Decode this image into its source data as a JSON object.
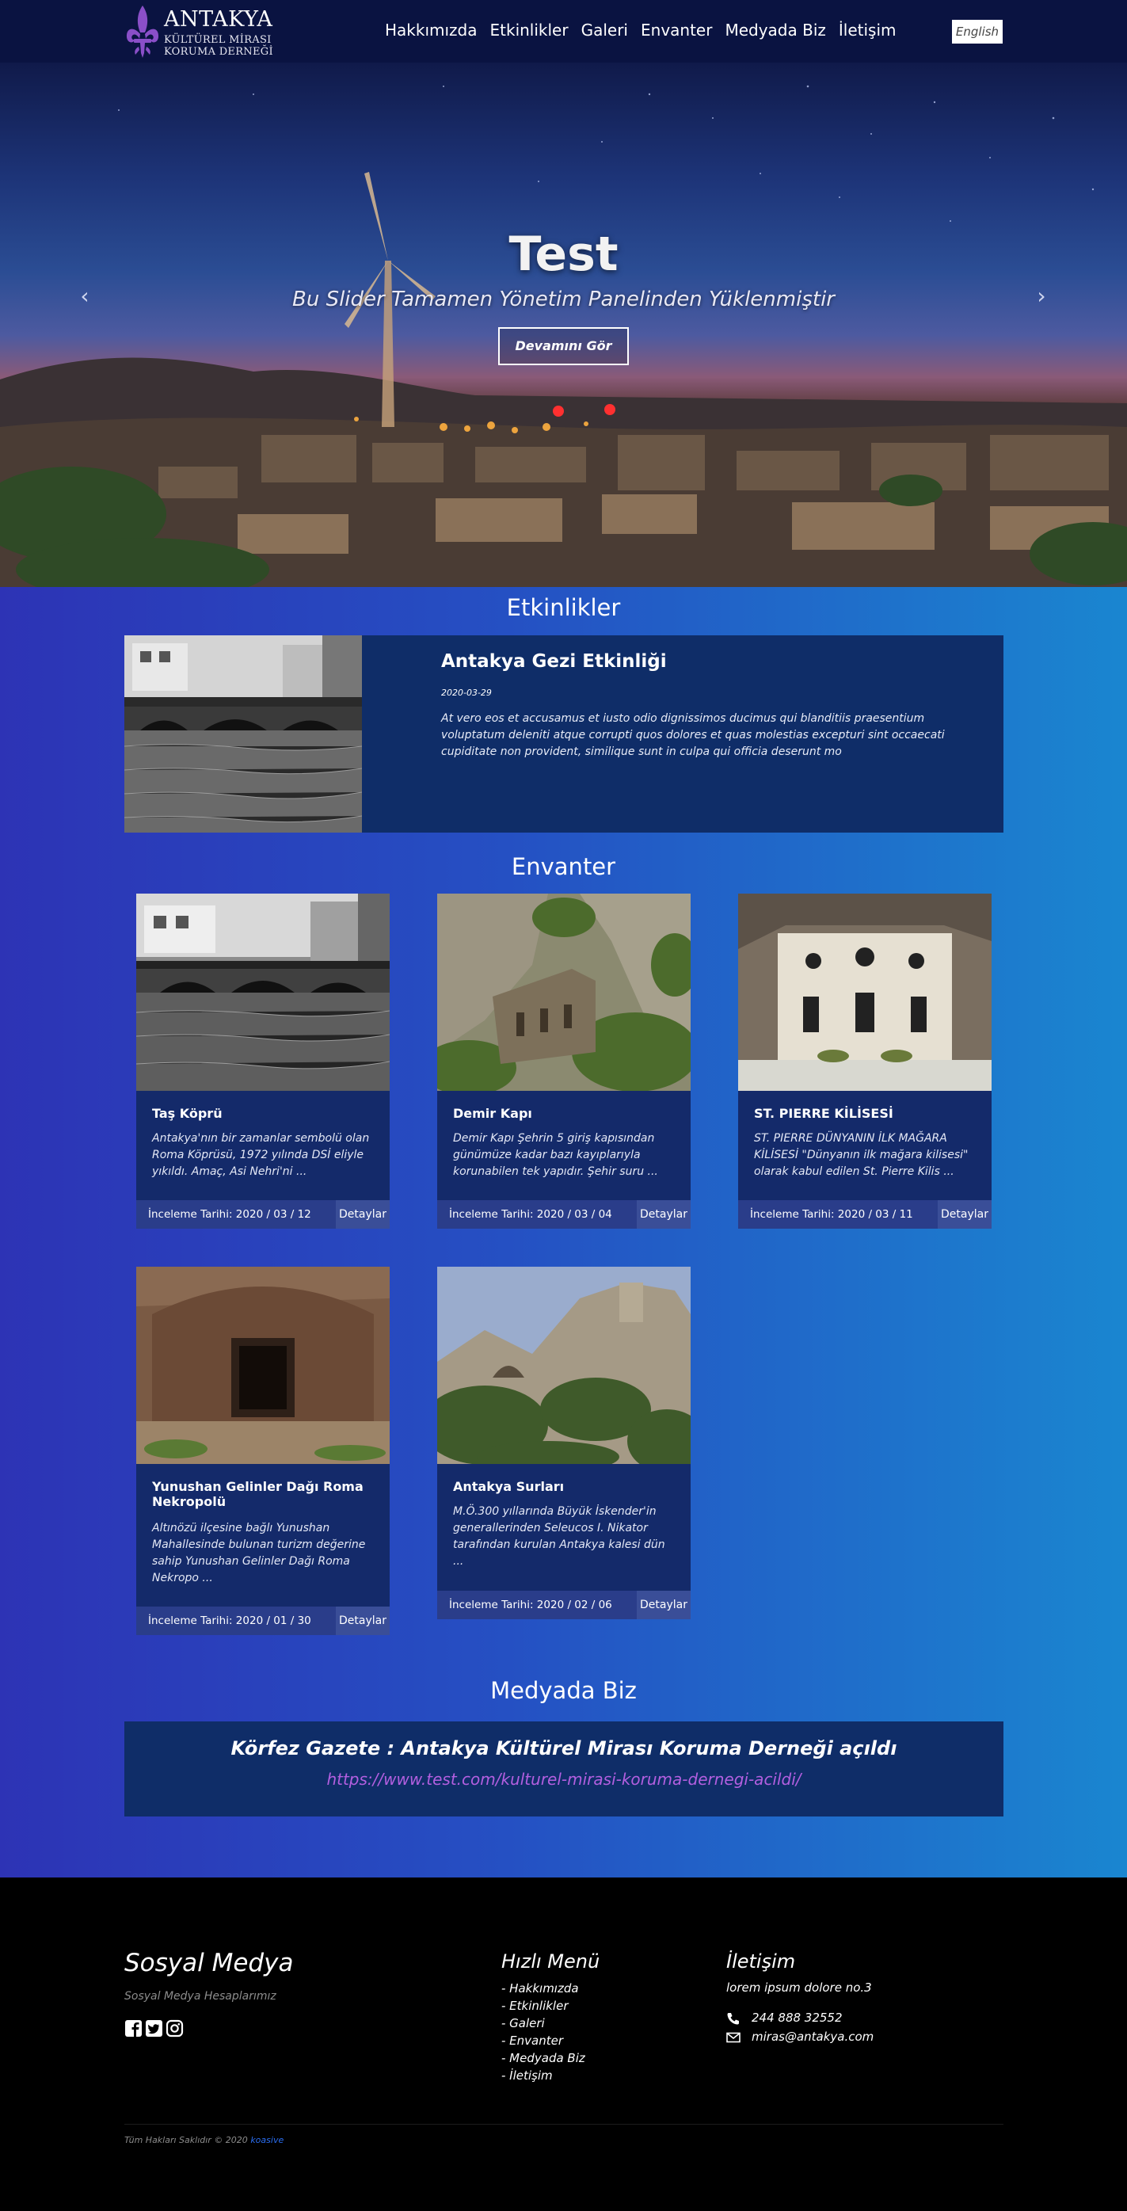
{
  "nav": {
    "logo": {
      "line1": "ANTAKYA",
      "line2": "KÜLTÜREL MİRASI",
      "line3": "KORUMA DERNEĞİ"
    },
    "menu": [
      "Hakkımızda",
      "Etkinlikler",
      "Galeri",
      "Envanter",
      "Medyada Biz",
      "İletişim"
    ],
    "language": "English"
  },
  "hero": {
    "title": "Test",
    "subtitle": "Bu Slider Tamamen Yönetim Panelinden Yüklenmiştir",
    "button": "Devamını Gör",
    "prev_icon": "chevron-left-icon",
    "next_icon": "chevron-right-icon"
  },
  "events": {
    "heading": "Etkinlikler",
    "items": [
      {
        "title": "Antakya Gezi Etkinliği",
        "date": "2020-03-29",
        "description": "At vero eos et accusamus et iusto odio dignissimos ducimus qui blanditiis praesentium voluptatum deleniti atque corrupti quos dolores et quas molestias excepturi sint occaecati cupiditate non provident, similique sunt in culpa qui officia deserunt mo"
      }
    ]
  },
  "inventory": {
    "heading": "Envanter",
    "date_prefix": "İnceleme Tarihi:",
    "details_label": "Detaylar",
    "items": [
      {
        "title": "Taş Köprü",
        "description": "Antakya'nın bir zamanlar sembolü olan Roma Köprüsü, 1972 yılında DSİ eliyle yıkıldı. Amaç, Asi Nehri'ni ...",
        "date": "İnceleme Tarihi: 2020 / 03 / 12"
      },
      {
        "title": "Demir Kapı",
        "description": "Demir Kapı Şehrin 5 giriş kapısından günümüze kadar bazı kayıplarıyla korunabilen tek yapıdır. Şehir suru ...",
        "date": "İnceleme Tarihi: 2020 / 03 / 04"
      },
      {
        "title": "ST. PIERRE KİLİSESİ",
        "description": "ST. PIERRE DÜNYANIN İLK MAĞARA KİLİSESİ \"Dünyanın ilk mağara kilisesi\" olarak kabul edilen St. Pierre Kilis ...",
        "date": "İnceleme Tarihi: 2020 / 03 / 11"
      },
      {
        "title": "Yunushan Gelinler Dağı Roma Nekropolü",
        "description": "Altınözü ilçesine bağlı Yunushan Mahallesinde bulunan turizm değerine sahip Yunushan Gelinler Dağı Roma Nekropo ...",
        "date": "İnceleme Tarihi: 2020 / 01 / 30"
      },
      {
        "title": "Antakya Surları",
        "description": "M.Ö.300 yıllarında Büyük İskender'in generallerinden Seleucos I. Nikator tarafından kurulan Antakya kalesi dün ...",
        "date": "İnceleme Tarihi: 2020 / 02 / 06"
      }
    ]
  },
  "media": {
    "heading": "Medyada Biz",
    "headline": "Körfez Gazete : Antakya Kültürel Mirası Koruma Derneği açıldı",
    "link": "https://www.test.com/kulturel-mirasi-koruma-dernegi-acildi/"
  },
  "footer": {
    "social": {
      "title": "Sosyal Medya",
      "subtitle": "Sosyal Medya Hesaplarımız",
      "icons": [
        "facebook-icon",
        "twitter-icon",
        "instagram-icon"
      ]
    },
    "quick_menu": {
      "title": "Hızlı Menü",
      "items": [
        "- Hakkımızda",
        "- Etkinlikler",
        "- Galeri",
        "- Envanter",
        "- Medyada Biz",
        "- İletişim"
      ]
    },
    "contact": {
      "title": "İletişim",
      "address": "lorem ipsum dolore no.3",
      "phone": "244 888 32552",
      "email": "miras@antakya.com"
    },
    "copyright": "Tüm Hakları Saklıdır © 2020",
    "copyright_link": "koasive"
  },
  "colors": {
    "nav_bg": "#0a1341",
    "card_bg": "#142a6a",
    "accent_link": "#b35fe0",
    "logo_purple": "#8a4fc8"
  }
}
